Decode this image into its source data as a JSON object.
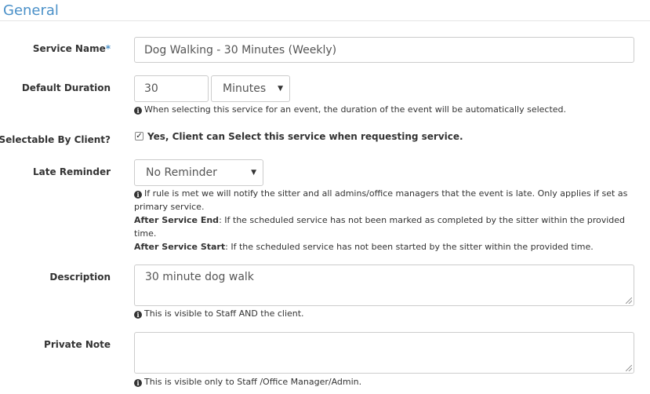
{
  "section": {
    "title": "General"
  },
  "service_name": {
    "label": "Service Name",
    "required_mark": "*",
    "value": "Dog Walking - 30 Minutes (Weekly)"
  },
  "default_duration": {
    "label": "Default Duration",
    "value": "30",
    "unit_selected": "Minutes",
    "help": "When selecting this service for an event, the duration of the event will be automatically selected."
  },
  "selectable_by_client": {
    "label": "Selectable By Client?",
    "checked": true,
    "checkbox_label": "Yes, Client can Select this service when requesting service."
  },
  "late_reminder": {
    "label": "Late Reminder",
    "selected": "No Reminder",
    "help_line1": "If rule is met we will notify the sitter and all admins/office managers that the event is late. Only applies if set as primary service.",
    "after_end_label": "After Service End",
    "after_end_text": ": If the scheduled service has not been marked as completed by the sitter within the provided time.",
    "after_start_label": "After Service Start",
    "after_start_text": ": If the scheduled service has not been started by the sitter within the provided time."
  },
  "description": {
    "label": "Description",
    "value": "30 minute dog walk",
    "help": "This is visible to Staff AND the client."
  },
  "private_note": {
    "label": "Private Note",
    "value": "",
    "help": "This is visible only to Staff /Office Manager/Admin."
  }
}
